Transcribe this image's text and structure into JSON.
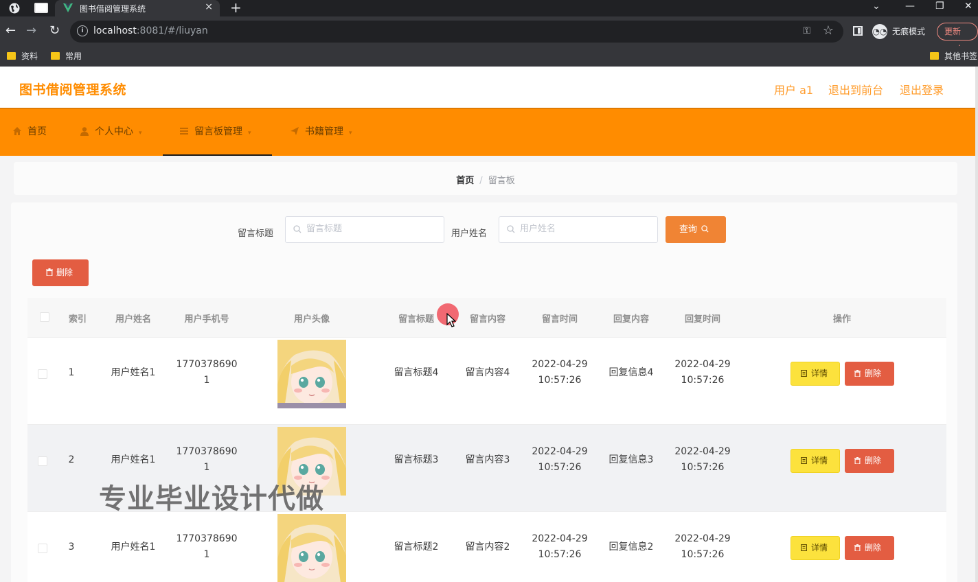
{
  "browser": {
    "tab_title": "图书借阅管理系统",
    "tab_close": "×",
    "new_tab": "+",
    "url_host": "localhost",
    "url_rest": ":8081/#/liuyan",
    "incognito_label": "无痕模式",
    "update_label": "更新",
    "bookmarks": [
      {
        "label": "资料"
      },
      {
        "label": "常用"
      },
      {
        "label": "其他书签"
      }
    ]
  },
  "header": {
    "site_title": "图书借阅管理系统",
    "links": [
      "用户 a1",
      "退出到前台",
      "退出登录"
    ]
  },
  "menu": {
    "items": [
      {
        "label": "首页",
        "icon": "home-icon",
        "active": false
      },
      {
        "label": "个人中心",
        "icon": "user-icon",
        "active": false
      },
      {
        "label": "留言板管理",
        "icon": "list-icon",
        "active": true
      },
      {
        "label": "书籍管理",
        "icon": "send-icon",
        "active": false
      }
    ]
  },
  "breadcrumb": {
    "home": "首页",
    "separator": "/",
    "current": "留言板"
  },
  "search": {
    "title_label": "留言标题",
    "title_placeholder": "留言标题",
    "title_value": "",
    "name_label": "用户姓名",
    "name_placeholder": "用户姓名",
    "name_value": "",
    "query_label": "查询"
  },
  "actions": {
    "bulk_delete_label": "删除"
  },
  "table": {
    "columns": [
      "索引",
      "用户姓名",
      "用户手机号",
      "用户头像",
      "留言标题",
      "留言内容",
      "留言时间",
      "回复内容",
      "回复时间",
      "操作"
    ],
    "rows": [
      {
        "index": "1",
        "name": "用户姓名1",
        "phone_a": "1770378690",
        "phone_b": "1",
        "title": "留言标题4",
        "content": "留言内容4",
        "time_date": "2022-04-29",
        "time_clock": "10:57:26",
        "reply": "回复信息4",
        "reply_date": "2022-04-29",
        "reply_clock": "10:57:26",
        "detail_label": "详情",
        "delete_label": "删除"
      },
      {
        "index": "2",
        "name": "用户姓名1",
        "phone_a": "1770378690",
        "phone_b": "1",
        "title": "留言标题3",
        "content": "留言内容3",
        "time_date": "2022-04-29",
        "time_clock": "10:57:26",
        "reply": "回复信息3",
        "reply_date": "2022-04-29",
        "reply_clock": "10:57:26",
        "detail_label": "详情",
        "delete_label": "删除"
      },
      {
        "index": "3",
        "name": "用户姓名1",
        "phone_a": "1770378690",
        "phone_b": "1",
        "title": "留言标题2",
        "content": "留言内容2",
        "time_date": "2022-04-29",
        "time_clock": "10:57:26",
        "reply": "回复信息2",
        "reply_date": "2022-04-29",
        "reply_clock": "10:57:26",
        "detail_label": "详情",
        "delete_label": "删除"
      }
    ]
  },
  "watermark": "专业毕业设计代做",
  "colors": {
    "accent": "#ff8c00",
    "header_title": "#ff8c00",
    "query_button": "#f08434",
    "delete_button": "#e35d42",
    "detail_button": "#fce23d"
  }
}
